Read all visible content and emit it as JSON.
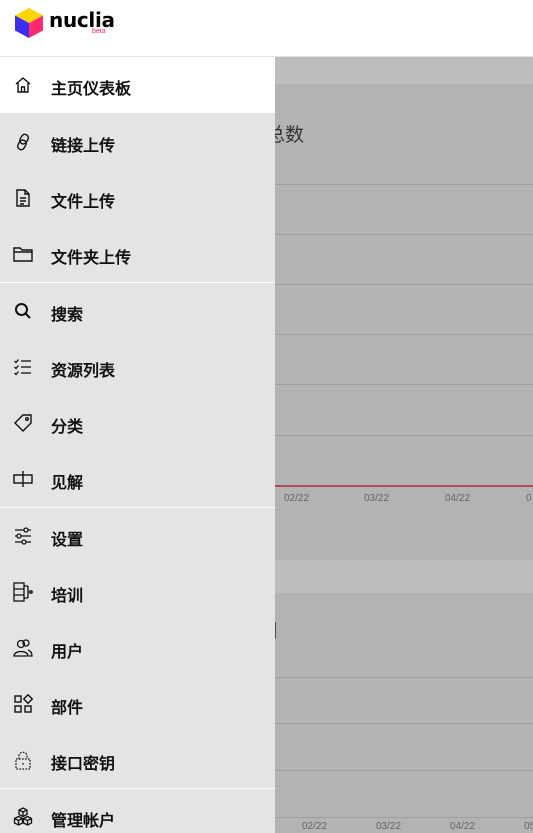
{
  "app": {
    "brand": "nuclia",
    "badge": "beta"
  },
  "dashboard": {
    "card1_title": "总数",
    "card2_title": "]",
    "ticks1": [
      "02/22",
      "03/22",
      "04/22",
      "0"
    ],
    "ticks2": [
      "02/22",
      "03/22",
      "04/22",
      "05"
    ]
  },
  "sidebar": {
    "items": [
      {
        "label": "主页仪表板",
        "icon": "home-icon",
        "active": true
      },
      {
        "label": "链接上传",
        "icon": "link-icon"
      },
      {
        "label": "文件上传",
        "icon": "file-icon"
      },
      {
        "label": "文件夹上传",
        "icon": "folder-icon"
      },
      {
        "label": "搜索",
        "icon": "search-icon"
      },
      {
        "label": "资源列表",
        "icon": "checklist-icon"
      },
      {
        "label": "分类",
        "icon": "tag-icon"
      },
      {
        "label": "见解",
        "icon": "insights-icon"
      },
      {
        "label": "设置",
        "icon": "sliders-icon"
      },
      {
        "label": "培训",
        "icon": "training-icon"
      },
      {
        "label": "用户",
        "icon": "users-icon"
      },
      {
        "label": "部件",
        "icon": "widgets-icon"
      },
      {
        "label": "接口密钥",
        "icon": "lock-icon"
      },
      {
        "label": "管理帐户",
        "icon": "cubes-icon"
      }
    ]
  },
  "colors": {
    "accent_pink": "#ff1f7a",
    "logo_yellow": "#ffd400",
    "logo_blue": "#2c3ee8",
    "logo_magenta": "#ff2a6d"
  }
}
